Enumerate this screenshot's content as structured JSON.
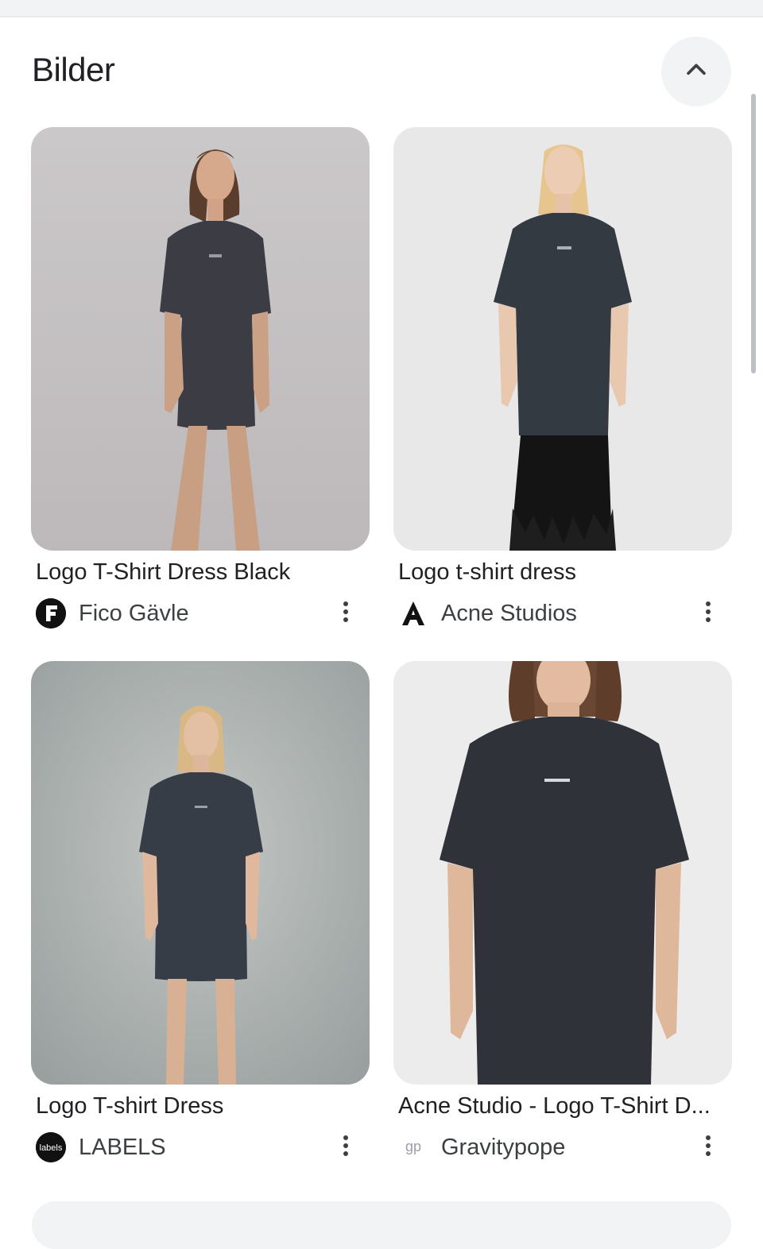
{
  "section": {
    "title": "Bilder",
    "collapse_icon": "chevron-up-icon"
  },
  "results": [
    {
      "title": "Logo T-Shirt Dress Black",
      "source": "Fico Gävle",
      "favicon_letter": "F",
      "favicon_bg": "#111111",
      "image_bg": "#c9c7c8"
    },
    {
      "title": "Logo t-shirt dress",
      "source": "Acne Studios",
      "favicon_letter": "A",
      "favicon_bg": "#ffffff",
      "image_bg": "#e9e9ea"
    },
    {
      "title": "Logo T-shirt Dress",
      "source": "LABELS",
      "favicon_letter": "labels",
      "favicon_bg": "#111111",
      "image_bg": "#aeb3b2"
    },
    {
      "title": "Acne Studio - Logo T-Shirt D...",
      "source": "Gravitypope",
      "favicon_letter": "gp",
      "favicon_bg": "#ffffff",
      "image_bg": "#ececec"
    }
  ],
  "colors": {
    "text_primary": "#202124",
    "text_secondary": "#3c4043",
    "chip_bg": "#f1f3f4"
  }
}
